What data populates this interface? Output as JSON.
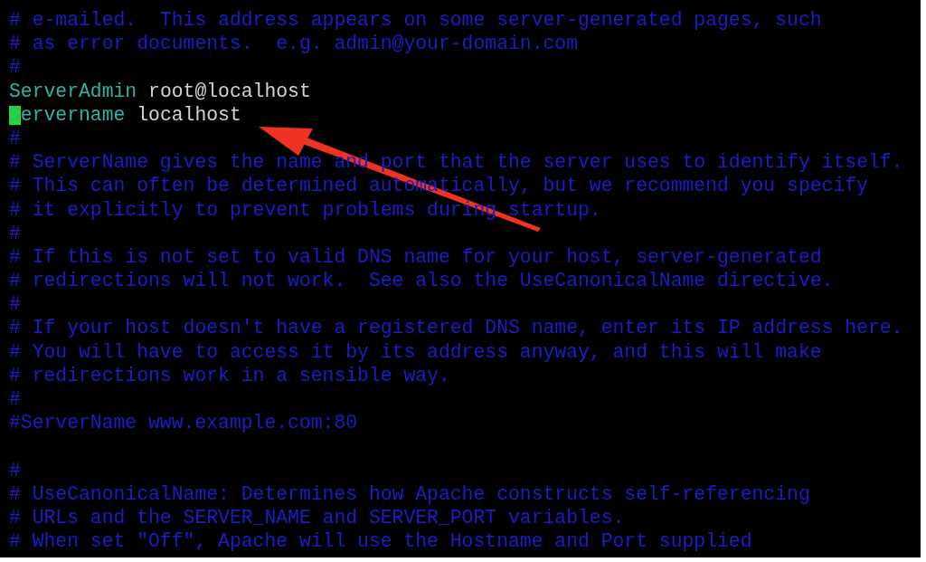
{
  "lines": [
    {
      "kind": "comment",
      "text": "# e-mailed.  This address appears on some server-generated pages, such"
    },
    {
      "kind": "comment",
      "text": "# as error documents.  e.g. admin@your-domain.com"
    },
    {
      "kind": "comment",
      "text": "#"
    },
    {
      "kind": "directive",
      "keyword": "ServerAdmin",
      "value": "root@localhost",
      "cursor": false
    },
    {
      "kind": "directive",
      "keyword": "Servername",
      "value": "localhost",
      "cursor": true
    },
    {
      "kind": "comment",
      "text": "#"
    },
    {
      "kind": "comment",
      "text": "# ServerName gives the name and port that the server uses to identify itself."
    },
    {
      "kind": "comment",
      "text": "# This can often be determined automatically, but we recommend you specify"
    },
    {
      "kind": "comment",
      "text": "# it explicitly to prevent problems during startup."
    },
    {
      "kind": "comment",
      "text": "#"
    },
    {
      "kind": "comment",
      "text": "# If this is not set to valid DNS name for your host, server-generated"
    },
    {
      "kind": "comment",
      "text": "# redirections will not work.  See also the UseCanonicalName directive."
    },
    {
      "kind": "comment",
      "text": "#"
    },
    {
      "kind": "comment",
      "text": "# If your host doesn't have a registered DNS name, enter its IP address here."
    },
    {
      "kind": "comment",
      "text": "# You will have to access it by its address anyway, and this will make"
    },
    {
      "kind": "comment",
      "text": "# redirections work in a sensible way."
    },
    {
      "kind": "comment",
      "text": "#"
    },
    {
      "kind": "comment",
      "text": "#ServerName www.example.com:80"
    },
    {
      "kind": "blank"
    },
    {
      "kind": "comment",
      "text": "#"
    },
    {
      "kind": "comment",
      "text": "# UseCanonicalName: Determines how Apache constructs self-referencing"
    },
    {
      "kind": "comment",
      "text": "# URLs and the SERVER_NAME and SERVER_PORT variables."
    },
    {
      "kind": "comment",
      "text": "# When set \"Off\", Apache will use the Hostname and Port supplied"
    }
  ]
}
